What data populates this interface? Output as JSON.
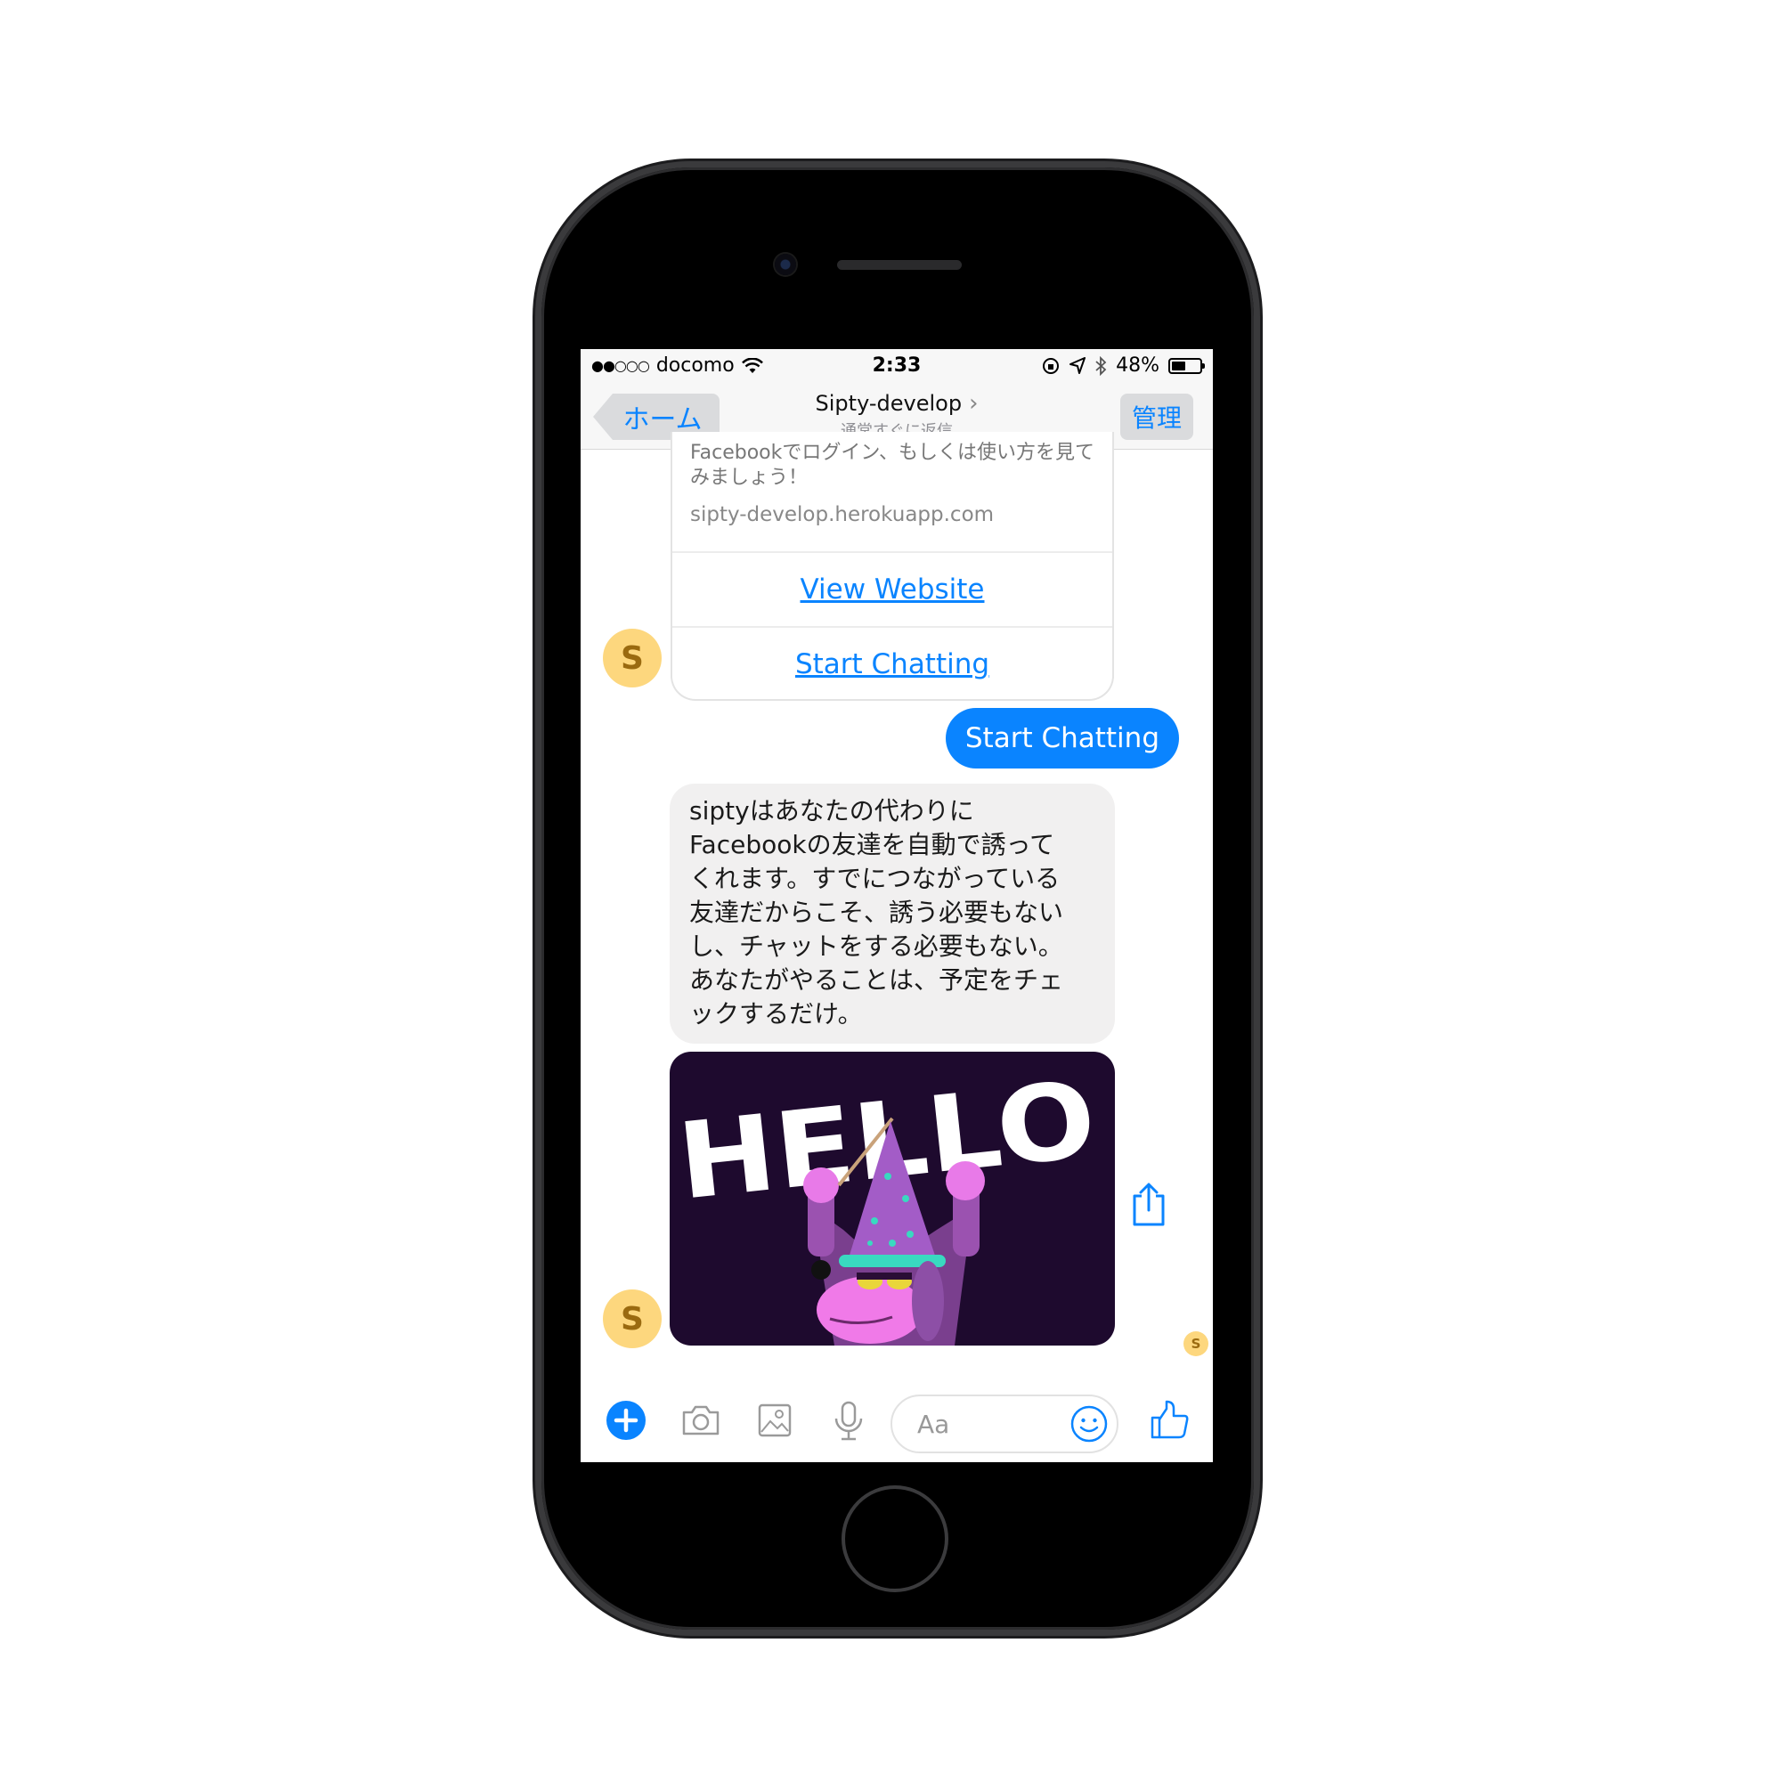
{
  "status_bar": {
    "signal": "●●○○○",
    "carrier": "docomo",
    "time": "2:33",
    "battery_percent": "48%",
    "battery_level": 0.48
  },
  "nav": {
    "back_label": "ホーム",
    "title": "Sipty-develop",
    "subtitle": "通常すぐに返信",
    "manage_label": "管理"
  },
  "card": {
    "description": "Facebookでログイン、もしくは使い方を見てみましょう！",
    "url": "sipty-develop.herokuapp.com",
    "buttons": [
      "View Website",
      "Start Chatting"
    ]
  },
  "avatar_letter": "S",
  "outgoing_message": "Start Chatting",
  "incoming_message": "siptyはあなたの代わりに\nFacebookの友達を自動で誘って\nくれます。すでにつながっている\n友達だからこそ、誘う必要もない\nし、チャットをする必要もない。\nあなたがやることは、予定をチェ\nックするだけ。",
  "sticker_text": "HELLO",
  "composer": {
    "placeholder": "Aa",
    "icons": [
      "plus-icon",
      "camera-icon",
      "image-icon",
      "microphone-icon",
      "emoji-icon",
      "thumbs-up-icon"
    ]
  },
  "colors": {
    "accent": "#0a84ff",
    "avatar_bg": "#fdd77e",
    "bubble_in": "#f1f0f0",
    "sticker_bg": "#1e0a2e"
  }
}
